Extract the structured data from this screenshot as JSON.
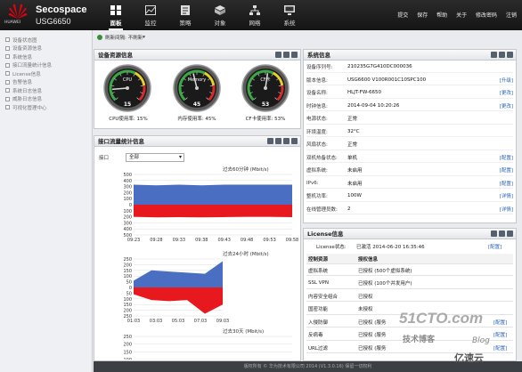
{
  "header": {
    "logo_text": "HUAWEI",
    "brand": "Secospace",
    "model": "USG6650",
    "tabs": [
      "面板",
      "监控",
      "策略",
      "对象",
      "网络",
      "系统"
    ],
    "active_tab": 0,
    "links": [
      "提交",
      "保存",
      "帮助",
      "关于",
      "修改密码",
      "注销"
    ]
  },
  "sidebar": {
    "items": [
      "设备状态图",
      "设备资源信息",
      "系统信息",
      "接口流量统计信息",
      "License信息",
      "告警信息",
      "系统日志信息",
      "威胁日志信息",
      "可视化管理中心"
    ]
  },
  "refresh": {
    "label": "刷新间隔:",
    "value": "不刷新"
  },
  "resource": {
    "title": "设备资源信息",
    "gauges": [
      {
        "name": "CPU",
        "value": 15,
        "caption": "CPU使用率: 15%"
      },
      {
        "name": "Memory",
        "value": 45,
        "caption": "内存使用率: 45%"
      },
      {
        "name": "CF卡",
        "value": 53,
        "caption": "CF卡使用率: 53%"
      }
    ]
  },
  "traffic": {
    "title": "接口流量统计信息",
    "iface_label": "接口",
    "iface_value": "全部",
    "chart1_title": "过去60分钟 (Mbit/s)",
    "chart2_title": "过去24小时 (Mbit/s)",
    "chart3_title": "过去30天 (Mbit/s)"
  },
  "chart_data": [
    {
      "type": "area",
      "title": "过去60分钟 (Mbit/s)",
      "x": [
        "09:23",
        "09:28",
        "09:33",
        "09:38",
        "09:43",
        "09:48",
        "09:53",
        "09:58"
      ],
      "yticks": [
        500,
        400,
        300,
        200,
        100,
        0,
        100,
        200,
        300,
        400,
        500
      ],
      "ylim": [
        -500,
        500
      ],
      "series": [
        {
          "values": [
            330,
            320,
            330,
            320,
            330,
            330,
            330,
            330
          ]
        },
        {
          "values": [
            -200,
            -210,
            -205,
            -210,
            -205,
            -200,
            -200,
            -205
          ]
        }
      ]
    },
    {
      "type": "area",
      "title": "过去24小时 (Mbit/s)",
      "x": [
        "01:03",
        "03:03",
        "05:03",
        "07:03",
        "09:03"
      ],
      "yticks": [
        250,
        200,
        150,
        100,
        50,
        0,
        50,
        100,
        150,
        200,
        250
      ],
      "ylim": [
        -250,
        250
      ],
      "series": [
        {
          "values": [
            60,
            150,
            140,
            130,
            120,
            230
          ]
        },
        {
          "values": [
            -60,
            -110,
            -120,
            -110,
            -230,
            -150
          ]
        }
      ]
    },
    {
      "type": "area",
      "title": "过去30天 (Mbit/s)",
      "x": [],
      "yticks": [
        250,
        200,
        150,
        100
      ],
      "ylim": [
        0,
        250
      ],
      "series": []
    }
  ],
  "sysinfo": {
    "title": "系统信息",
    "rows": [
      {
        "k": "设备序列号:",
        "v": "210235G7G410DC000036",
        "a": ""
      },
      {
        "k": "版本信息:",
        "v": "USG6600 V100R001C10SPC100",
        "a": "[升级]"
      },
      {
        "k": "设备名称:",
        "v": "HLJT-FW-6650",
        "a": "[更改]"
      },
      {
        "k": "时钟信息:",
        "v": "2014-09-04 10:20:26",
        "a": "[更改]"
      },
      {
        "k": "电源状态:",
        "v": "正常",
        "a": ""
      },
      {
        "k": "环境温度:",
        "v": "32°C",
        "a": ""
      },
      {
        "k": "风扇状态:",
        "v": "正常",
        "a": ""
      },
      {
        "k": "双机热备状态:",
        "v": "单机",
        "a": "[配置]"
      },
      {
        "k": "虚拟系统:",
        "v": "未启用",
        "a": "[配置]"
      },
      {
        "k": "IPv6:",
        "v": "未启用",
        "a": "[配置]"
      },
      {
        "k": "整机功率:",
        "v": "100W",
        "a": "[详情]"
      },
      {
        "k": "在线管理员数:",
        "v": "2",
        "a": "[详情]"
      }
    ]
  },
  "license": {
    "title": "License信息",
    "status_label": "License状态:",
    "status_value": "已激活 2014-06-20 16:35:46",
    "status_action": "[配置]",
    "col1": "控制资源",
    "col2": "授权信息",
    "rows": [
      {
        "k": "虚拟系统",
        "v": "已授权 (500个虚拟系统)",
        "a": ""
      },
      {
        "k": "SSL VPN",
        "v": "已授权 (100个并发用户)",
        "a": ""
      },
      {
        "k": "内容安全组合",
        "v": "已授权",
        "a": ""
      },
      {
        "k": "国密功能",
        "v": "未授权",
        "a": ""
      },
      {
        "k": "入侵防御",
        "v": "已授权 (服务",
        "a": "[配置]"
      },
      {
        "k": "反病毒",
        "v": "已授权 (服务",
        "a": "[配置]"
      },
      {
        "k": "URL过滤",
        "v": "已授权 (服务",
        "a": "[配置]"
      }
    ]
  },
  "statusbar": "版权所有 © 华为技术有限公司 2014 (V1.3.0.16) 保留一切权利",
  "watermark": {
    "a": "51CTO.com",
    "b": "技术博客",
    "c": "Blog",
    "d": "亿速云"
  },
  "colors": {
    "inbound": "#4a6ec2",
    "outbound": "#e8191e",
    "topbar": "#1c1c1c",
    "link": "#2a62b8"
  }
}
